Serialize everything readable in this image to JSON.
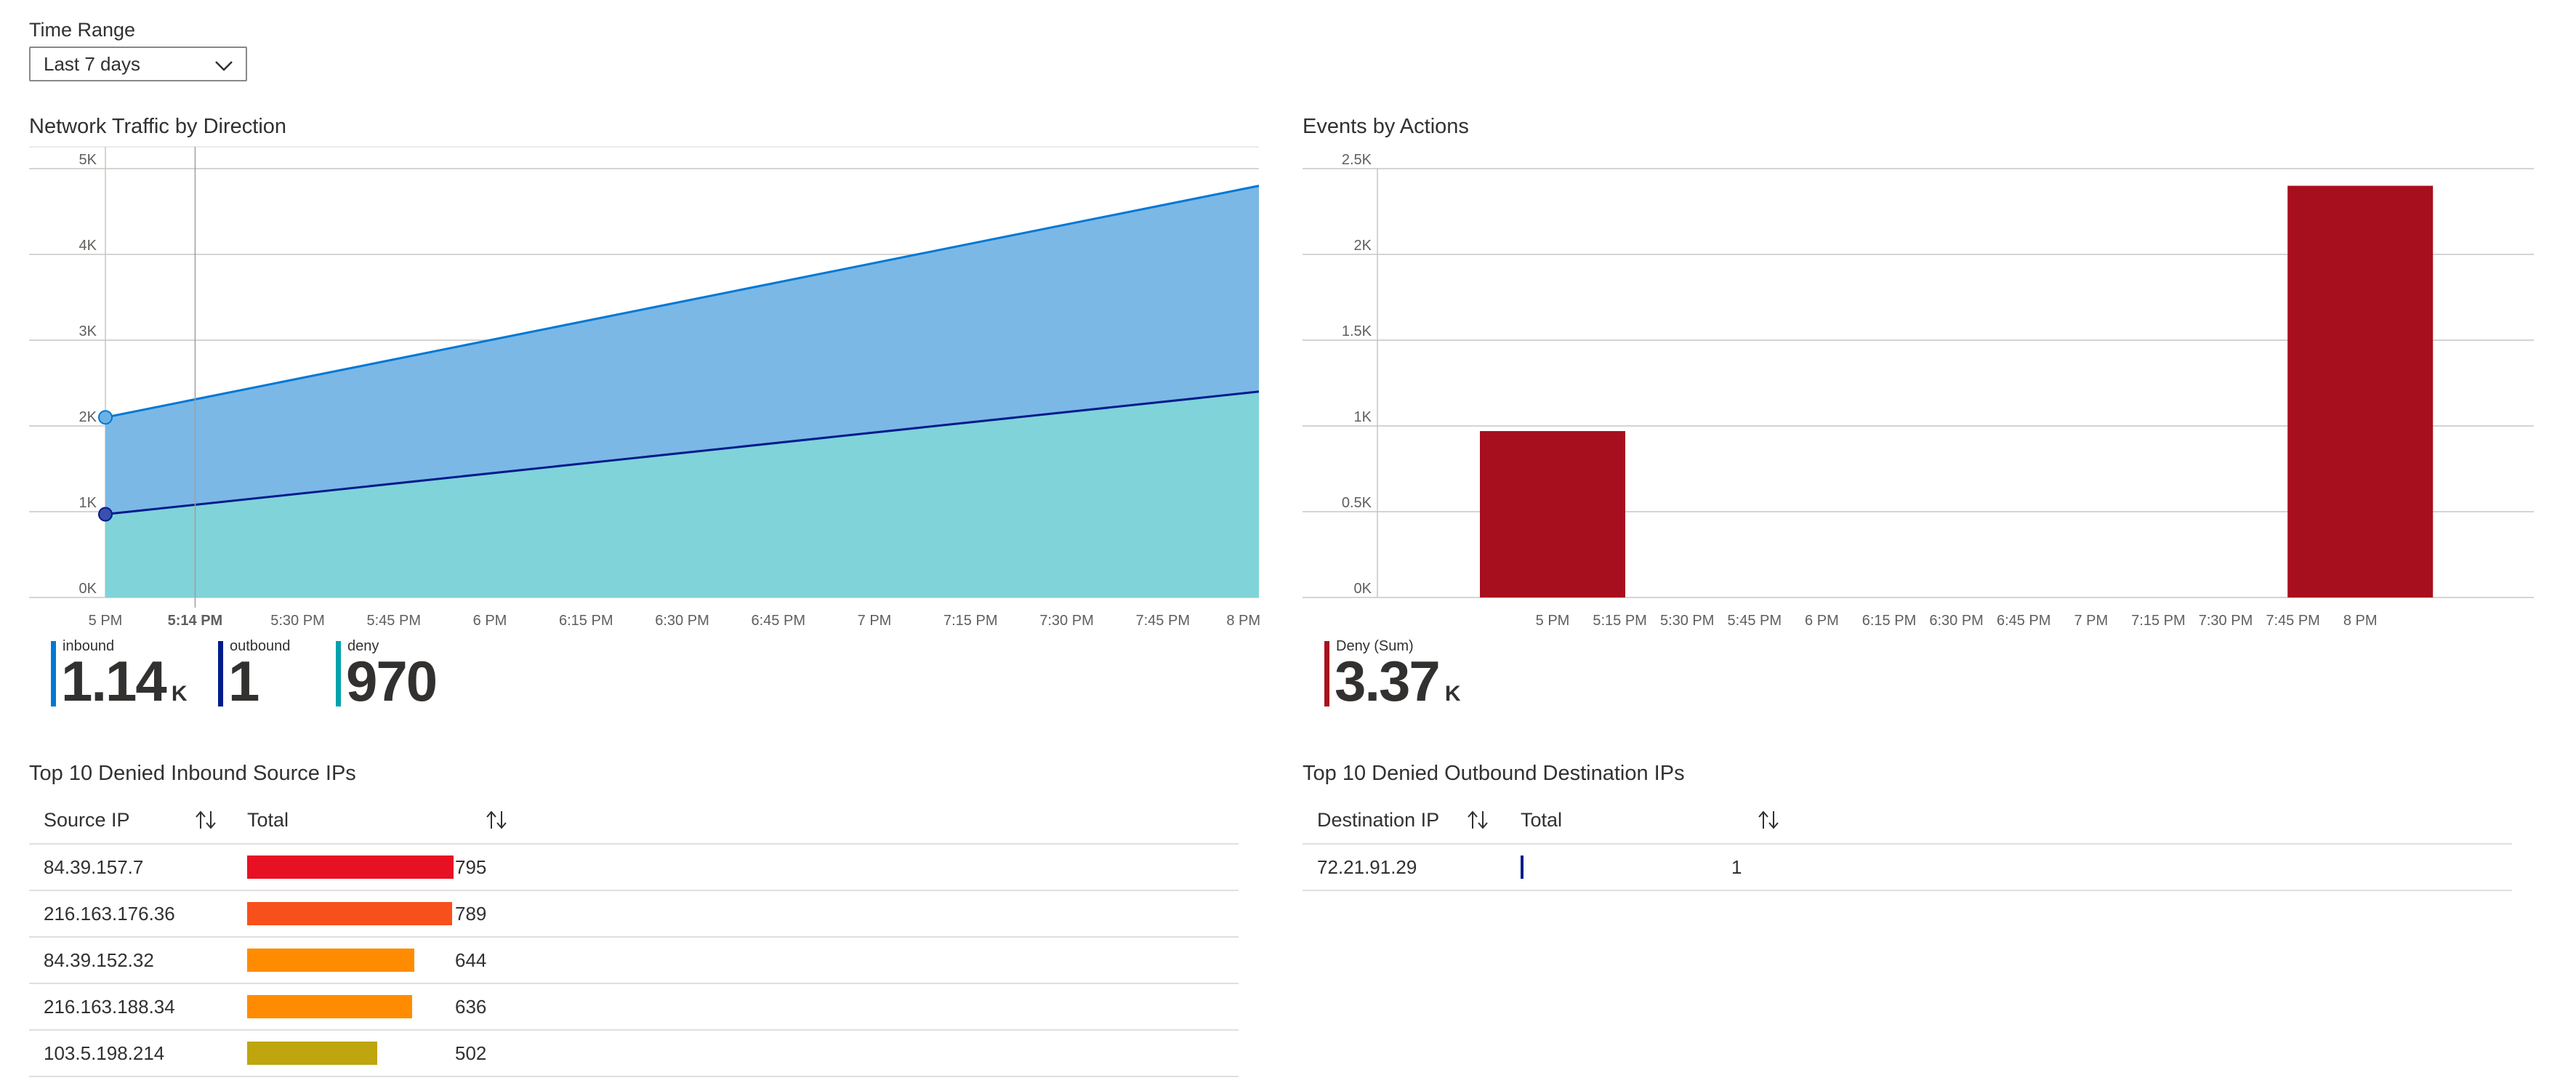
{
  "time_range": {
    "label": "Time Range",
    "selected": "Last 7 days",
    "chevron_icon": "chevron-down-icon"
  },
  "network_traffic": {
    "title": "Network Traffic by Direction",
    "chart_data": {
      "type": "area",
      "x": [
        "5 PM",
        "5:14 PM",
        "5:30 PM",
        "5:45 PM",
        "6 PM",
        "6:15 PM",
        "6:30 PM",
        "6:45 PM",
        "7 PM",
        "7:15 PM",
        "7:30 PM",
        "7:45 PM",
        "8 PM"
      ],
      "yticks": [
        "0K",
        "1K",
        "2K",
        "3K",
        "4K",
        "5K"
      ],
      "ylim": [
        0,
        5000
      ],
      "xlim_minutes": [
        0,
        180
      ],
      "hover_x_label": "5:14 PM",
      "series": [
        {
          "name": "inbound",
          "color": "#0078d4",
          "fill": "#7bb8e6",
          "points": [
            [
              0,
              2100
            ],
            [
              180,
              4800
            ]
          ]
        },
        {
          "name": "outbound",
          "color": "#001b8c",
          "fill": "#7fd3d9",
          "points": [
            [
              0,
              970
            ],
            [
              180,
              2400
            ]
          ]
        }
      ]
    },
    "legend": [
      {
        "name": "inbound",
        "value": "1.14",
        "unit": "K",
        "color": "#0078d4"
      },
      {
        "name": "outbound",
        "value": "1",
        "unit": "",
        "color": "#001b8c"
      },
      {
        "name": "deny",
        "value": "970",
        "unit": "",
        "color": "#00a2ad"
      }
    ]
  },
  "events_by_actions": {
    "title": "Events by Actions",
    "chart_data": {
      "type": "bar",
      "categories": [
        "5 PM",
        "5:15 PM",
        "5:30 PM",
        "5:45 PM",
        "6 PM",
        "6:15 PM",
        "6:30 PM",
        "6:45 PM",
        "7 PM",
        "7:15 PM",
        "7:30 PM",
        "7:45 PM",
        "8 PM"
      ],
      "yticks": [
        "0K",
        "0.5K",
        "1K",
        "1.5K",
        "2K",
        "2.5K"
      ],
      "ylim": [
        0,
        2500
      ],
      "series": [
        {
          "name": "Deny (Sum)",
          "color": "#a80f1e",
          "values": [
            970,
            0,
            0,
            0,
            0,
            0,
            0,
            0,
            0,
            0,
            0,
            0,
            2400
          ]
        }
      ]
    },
    "legend": [
      {
        "name": "Deny (Sum)",
        "value": "3.37",
        "unit": "K",
        "color": "#a80f1e"
      }
    ]
  },
  "inbound_table": {
    "title": "Top 10 Denied Inbound Source IPs",
    "headers": [
      "Source IP",
      "Total"
    ],
    "sort_icon": "sort-arrows-icon",
    "max": 795,
    "rows": [
      {
        "ip": "84.39.157.7",
        "total": "795",
        "value": 795,
        "color": "#e81123"
      },
      {
        "ip": "216.163.176.36",
        "total": "789",
        "value": 789,
        "color": "#f7501c"
      },
      {
        "ip": "84.39.152.32",
        "total": "644",
        "value": 644,
        "color": "#ff8c00"
      },
      {
        "ip": "216.163.188.34",
        "total": "636",
        "value": 636,
        "color": "#ff8c00"
      },
      {
        "ip": "103.5.198.214",
        "total": "502",
        "value": 502,
        "color": "#bfa50e"
      }
    ]
  },
  "outbound_table": {
    "title": "Top 10 Denied Outbound Destination IPs",
    "headers": [
      "Destination IP",
      "Total"
    ],
    "sort_icon": "sort-arrows-icon",
    "rows": [
      {
        "ip": "72.21.91.29",
        "total": "1",
        "value": 1,
        "color": "#001b8c"
      }
    ]
  }
}
